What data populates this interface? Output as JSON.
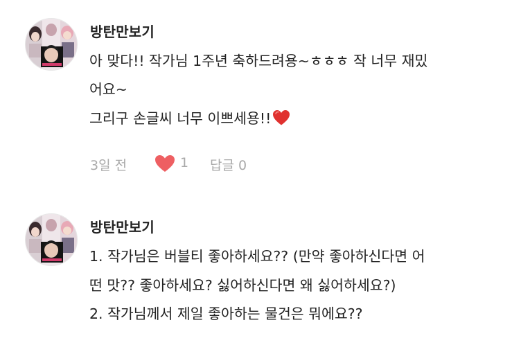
{
  "comments": [
    {
      "author": "방탄만보기",
      "lines": [
        "아 맞다!! 작가님 1주년 축하드려용~ㅎㅎㅎ 작 너무 재밌",
        "어요~",
        "그리구 손글씨 너무 이쁘세용!!"
      ],
      "emoji": "red-heart",
      "time": "3일 전",
      "like_count": "1",
      "reply_label": "답글 0",
      "heart_color": "#ee5f62"
    },
    {
      "author": "방탄만보기",
      "lines": [
        "1. 작가님은 버블티 좋아하세요?? (만약 좋아하신다면 어",
        "떤 맛?? 좋아하세요? 싫어하신다면 왜 싫어하세요?)",
        "2. 작가님께서 제일 좋아하는 물건은 뭐에요??"
      ]
    }
  ]
}
